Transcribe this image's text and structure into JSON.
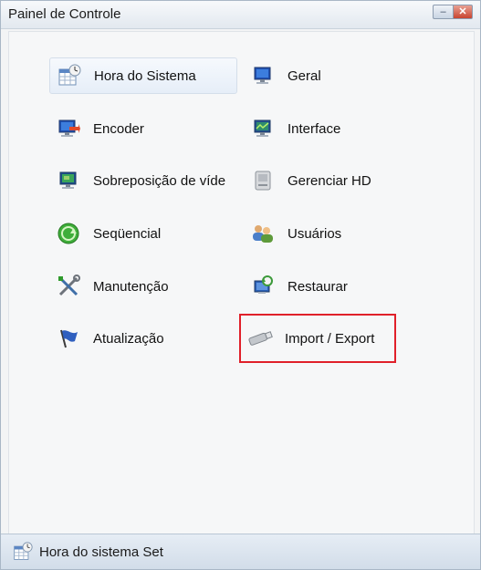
{
  "window": {
    "title": "Painel de Controle",
    "minimize_icon": "minimize-icon",
    "close_icon": "close-icon"
  },
  "menu": {
    "items": [
      {
        "label": "Hora do Sistema",
        "icon": "calendar-clock-icon",
        "selected": true
      },
      {
        "label": "Geral",
        "icon": "monitor-icon"
      },
      {
        "label": "Encoder",
        "icon": "monitor-arrow-icon"
      },
      {
        "label": "Interface",
        "icon": "monitor-display-icon"
      },
      {
        "label": "Sobreposição de víde",
        "icon": "video-overlay-icon"
      },
      {
        "label": "Gerenciar HD",
        "icon": "hard-disk-icon"
      },
      {
        "label": "Seqüencial",
        "icon": "sequence-cycle-icon"
      },
      {
        "label": "Usuários",
        "icon": "users-icon"
      },
      {
        "label": "Manutenção",
        "icon": "tools-icon"
      },
      {
        "label": "Restaurar",
        "icon": "restore-icon"
      },
      {
        "label": "Atualização",
        "icon": "update-flag-icon"
      },
      {
        "label": "Import / Export",
        "icon": "usb-drive-icon",
        "highlighted": true
      }
    ]
  },
  "status": {
    "text": "Hora do sistema Set",
    "icon": "calendar-clock-icon"
  },
  "colors": {
    "highlight_border": "#e0202a",
    "accent_blue": "#2a63c8",
    "accent_green": "#2f9a2c"
  }
}
